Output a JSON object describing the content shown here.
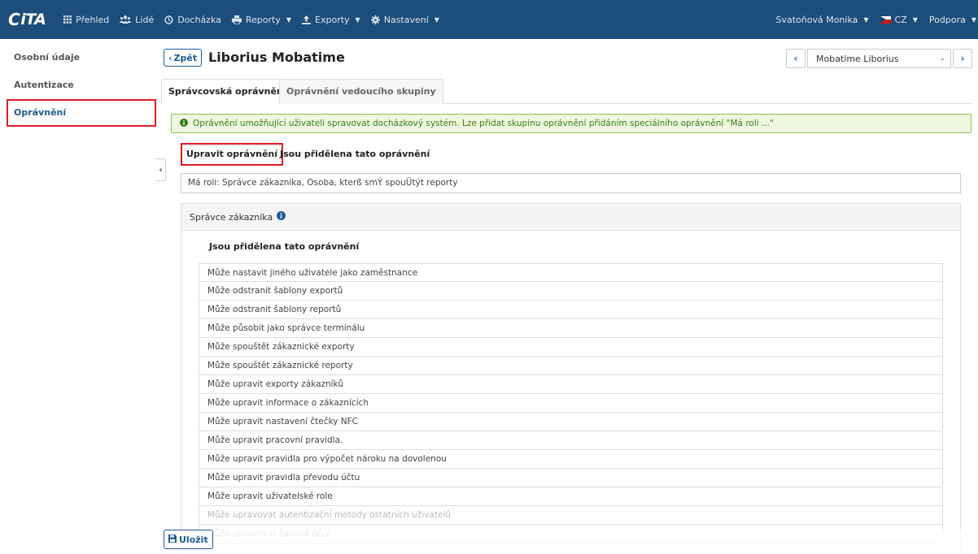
{
  "brand": {
    "logo_text": "CiTA",
    "color": "#1d4d7a"
  },
  "navbar": {
    "items": [
      {
        "label": "Přehled",
        "icon": "grid-icon"
      },
      {
        "label": "Lidé",
        "icon": "users-icon"
      },
      {
        "label": "Docházka",
        "icon": "clock-icon"
      },
      {
        "label": "Reporty",
        "icon": "printer-icon",
        "dropdown": true
      },
      {
        "label": "Exporty",
        "icon": "export-icon",
        "dropdown": true
      },
      {
        "label": "Nastavení",
        "icon": "gear-icon",
        "dropdown": true
      }
    ],
    "user": "Svatoňová Monika",
    "language": "CZ",
    "support": "Podpora"
  },
  "sidebar": {
    "items": [
      {
        "label": "Osobní údaje"
      },
      {
        "label": "Autentizace"
      },
      {
        "label": "Oprávnění",
        "active": true
      }
    ]
  },
  "header": {
    "back_label": "Zpět",
    "title": "Liborius Mobatime",
    "employee_select": "Mobatime Liborius"
  },
  "tabs": [
    {
      "label": "Správcovská oprávnění",
      "active": true
    },
    {
      "label": "Oprávnění vedoucího skupiny",
      "active": false
    }
  ],
  "alert": {
    "text": "Oprávnění umožňující uživateli spravovat docházkový systém. Lze přidat skupinu oprávnění přidáním speciálního oprávnění \"Má roli ...\""
  },
  "inner_tabs": [
    {
      "label": "Upravit oprávnění",
      "active": true
    },
    {
      "label": "Jsou přidělena tato oprávnění",
      "active": false
    }
  ],
  "roles_field": "Má roli: Správce zákazníka, Osoba, kterß smÝ spouÜtýt reporty",
  "panel": {
    "title": "Správce zákazníka",
    "sub_heading": "Jsou přidělena tato oprávnění",
    "permissions": [
      "Může nastavit jiného uživatele jako zaměstnance",
      "Může odstranit šablony exportů",
      "Může odstranit šablony reportů",
      "Může působit jako správce terminálu",
      "Může spouštět zákaznické exporty",
      "Může spouštět zákaznické reporty",
      "Může upravit exporty zákazníků",
      "Může upravit informace o zákaznících",
      "Může upravit nastavení čtečky NFC",
      "Může upravit pracovní pravidla.",
      "Může upravit pravidla pro výpočet nároku na dovolenou",
      "Může upravit pravidla převodu účtu",
      "Může upravit uživatelské role",
      "Může upravovat autentizační metody ostatních uživatelů",
      "Může upravovat časové účty"
    ]
  },
  "save_label": "Uložit",
  "colors": {
    "accent": "#1d5b94",
    "highlight": "#e01b24",
    "alert_bg": "#edf8df",
    "alert_text": "#3d7a1a"
  }
}
